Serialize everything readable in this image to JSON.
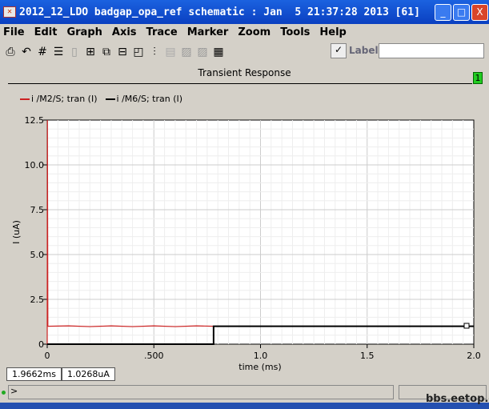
{
  "window": {
    "title": "2012_12_LDO badgap_opa_ref schematic : Jan  5 21:37:28 2013 [61]",
    "minimize": "_",
    "maximize": "□",
    "close": "X"
  },
  "menu": [
    "File",
    "Edit",
    "Graph",
    "Axis",
    "Trace",
    "Marker",
    "Zoom",
    "Tools",
    "Help"
  ],
  "toolbar": {
    "icons": [
      "printer-icon",
      "undo-icon",
      "grid-icon",
      "strips-icon",
      "blank-icon",
      "split-icon",
      "copy-icon",
      "window-icon",
      "resize-icon",
      "bars-icon",
      "disabled-icon-1",
      "disabled-icon-2",
      "disabled-icon-3",
      "calculator-icon"
    ],
    "label_check": "✓",
    "label_text": "Label",
    "label_value": ""
  },
  "graph": {
    "title": "Transient Response",
    "badge": "1"
  },
  "chart_data": {
    "type": "line",
    "title": "Transient Response",
    "xlabel": "time (ms)",
    "ylabel": "I (uA)",
    "xlim": [
      0,
      2.0
    ],
    "ylim": [
      0,
      12.5
    ],
    "xticks": [
      "0",
      ".500",
      "1.0",
      "1.5",
      "2.0"
    ],
    "xtick_values": [
      0,
      0.5,
      1.0,
      1.5,
      2.0
    ],
    "yticks": [
      "0",
      "2.5",
      "5.0",
      "7.5",
      "10.0",
      "12.5"
    ],
    "ytick_values": [
      0,
      2.5,
      5.0,
      7.5,
      10.0,
      12.5
    ],
    "grid": true,
    "legend_position": "top-left",
    "series": [
      {
        "name": "i /M2/S; tran (I)",
        "color": "#cc2222",
        "x": [
          0,
          0.001,
          0.003,
          0.1,
          0.2,
          0.3,
          0.4,
          0.5,
          0.6,
          0.7,
          0.78,
          1.0,
          1.5,
          2.0
        ],
        "y": [
          0,
          12.5,
          1.0,
          1.02,
          0.98,
          1.02,
          0.98,
          1.02,
          0.98,
          1.02,
          1.0,
          1.0,
          1.0,
          1.0
        ]
      },
      {
        "name": "i /M6/S; tran (I)",
        "color": "#000000",
        "x": [
          0,
          0.78,
          0.78,
          1.0,
          1.5,
          2.0
        ],
        "y": [
          0,
          0,
          1.0,
          1.0,
          1.0,
          1.0
        ]
      }
    ]
  },
  "readout": {
    "x": "1.9662ms",
    "y": "1.0268uA"
  },
  "command": {
    "prompt": ">"
  },
  "watermark": "bbs.eetop.cn"
}
